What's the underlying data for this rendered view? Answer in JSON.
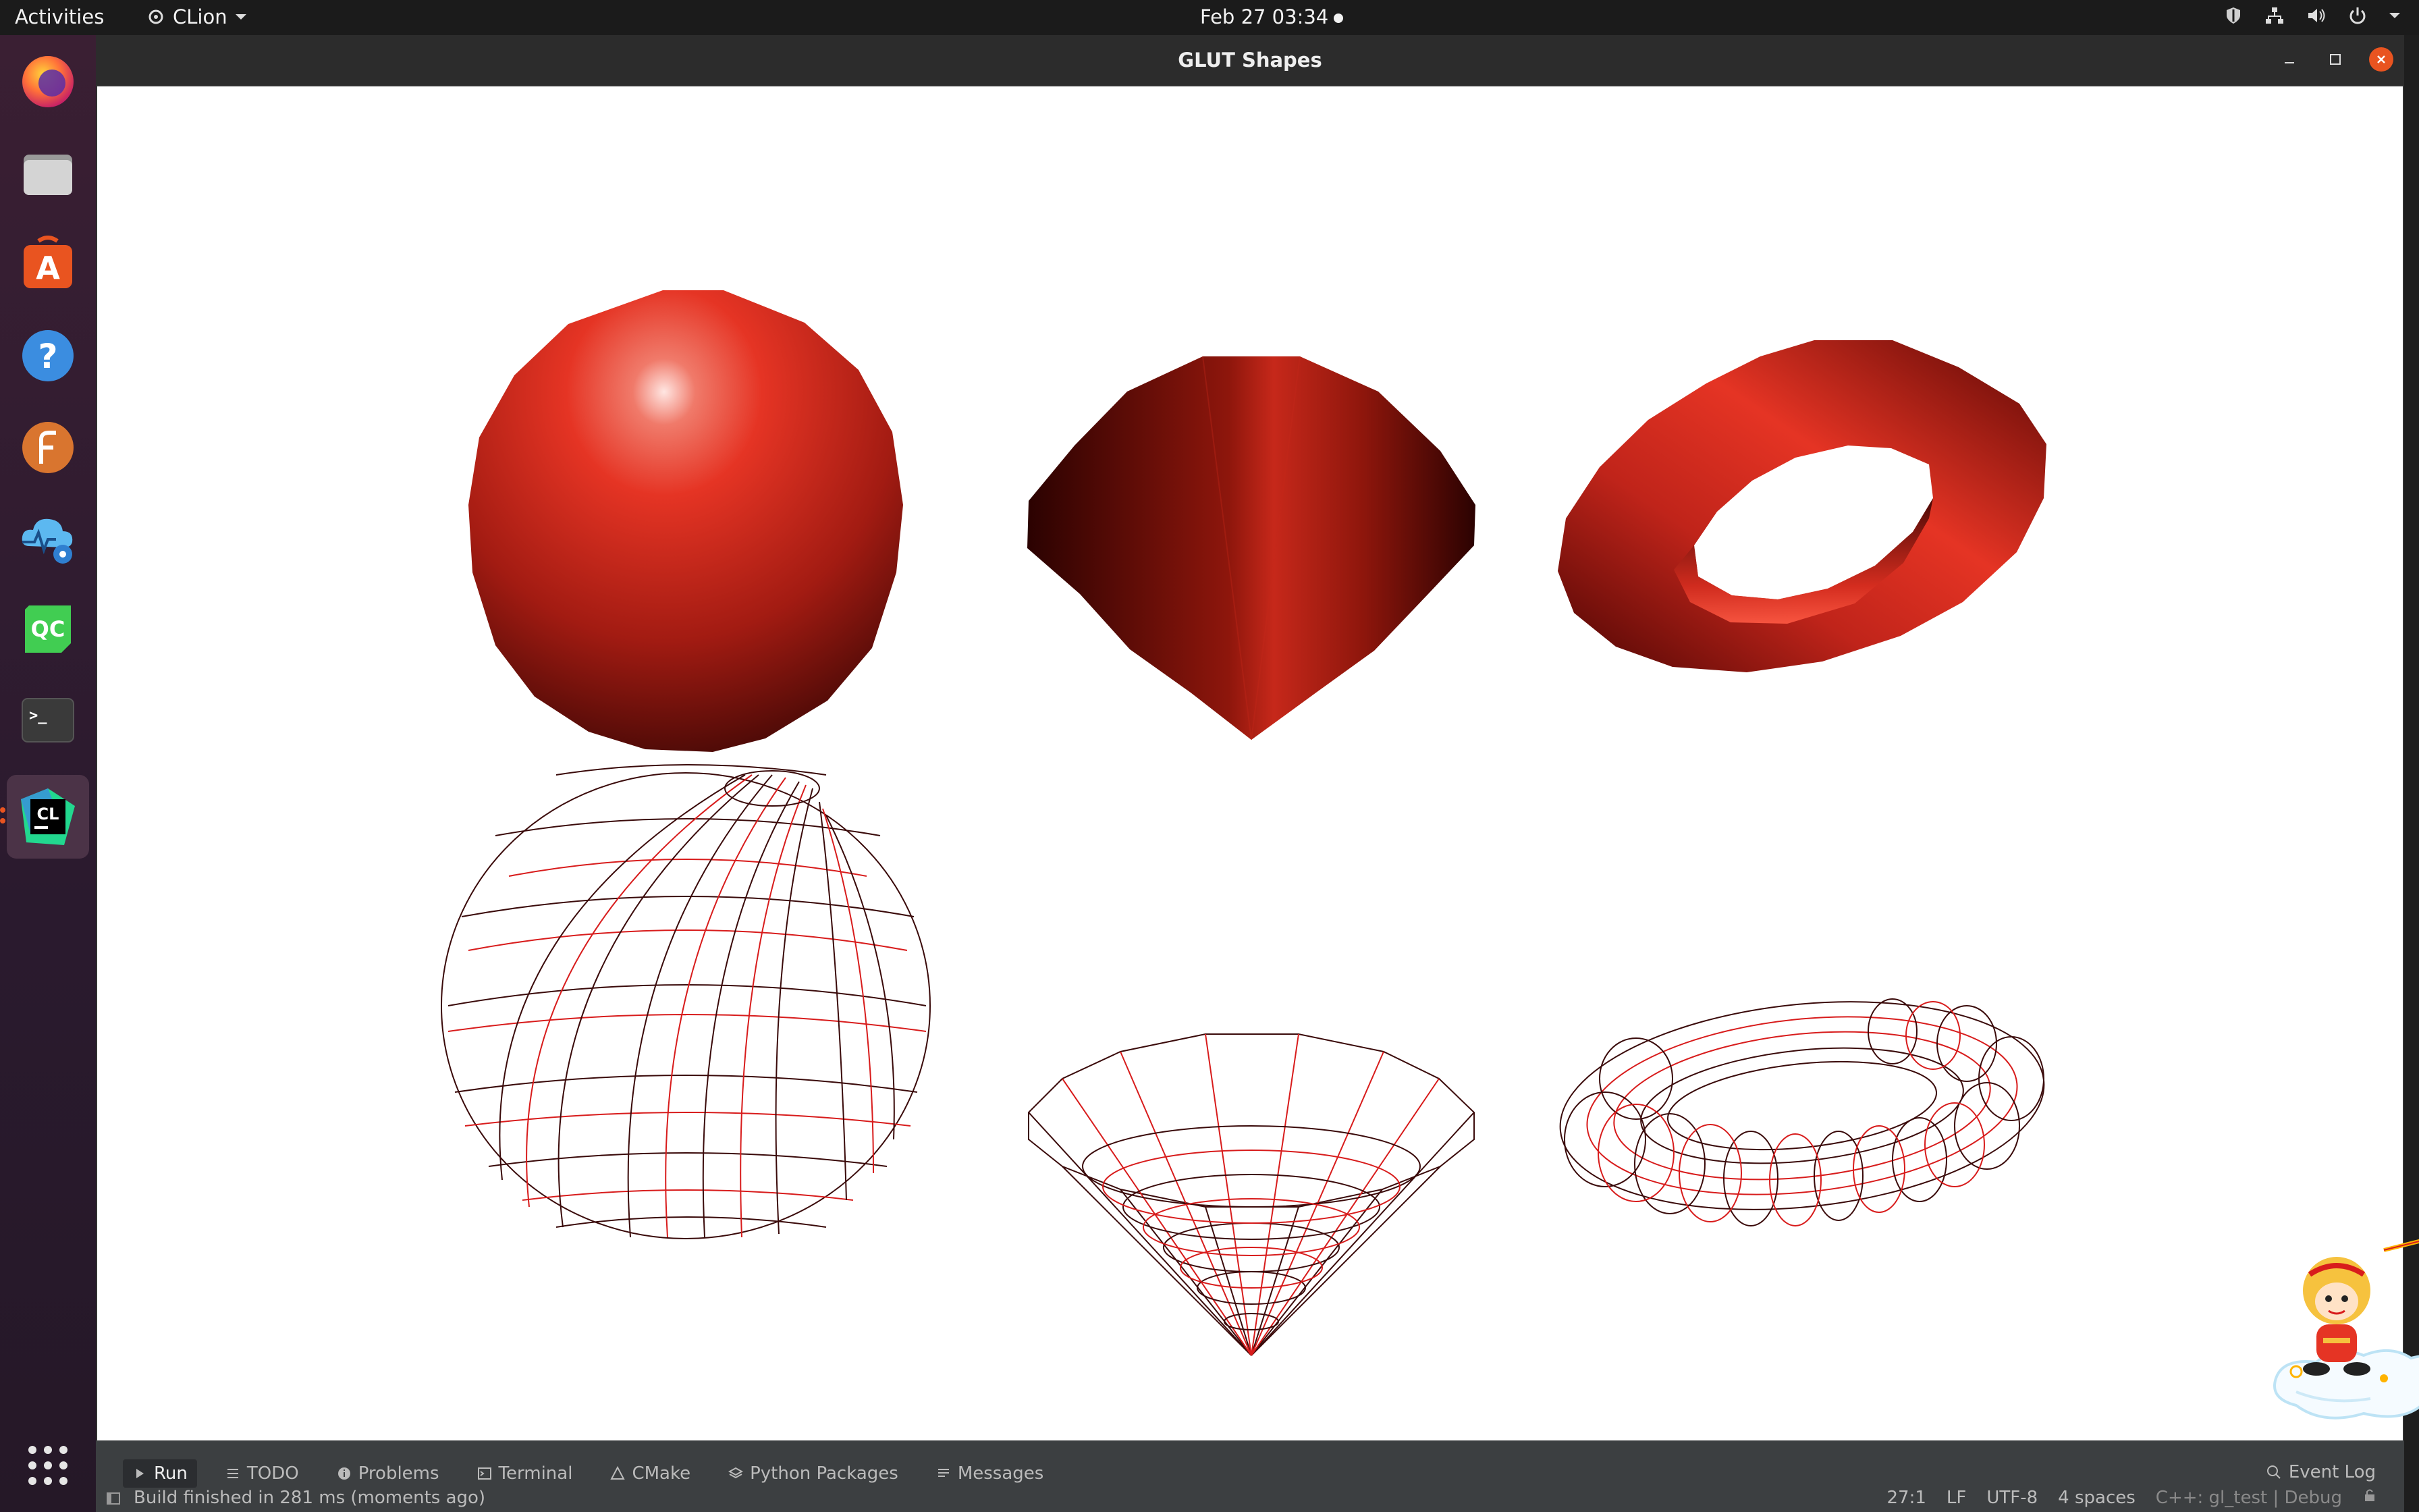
{
  "topbar": {
    "activities": "Activities",
    "app_name": "CLion",
    "clock": "Feb 27  03:34"
  },
  "dock": {
    "items": [
      {
        "name": "firefox-icon",
        "color": "#ff7139"
      },
      {
        "name": "files-icon",
        "color": "#b8b8b8"
      },
      {
        "name": "app-store-icon",
        "color": "#e95420",
        "label": "A"
      },
      {
        "name": "help-icon",
        "color": "#3b8de0",
        "label": "?"
      },
      {
        "name": "fontforge-icon",
        "color": "#d9752f",
        "label": "F"
      },
      {
        "name": "cloud-monitor-icon",
        "color": "#3aa0e8"
      },
      {
        "name": "qt-creator-icon",
        "color": "#41cd52",
        "label": "QC"
      },
      {
        "name": "terminal-icon",
        "color": "#2d2d2d",
        "label": ">_"
      },
      {
        "name": "clion-icon",
        "color": "#22d88f",
        "label": "CL"
      }
    ],
    "show_apps_icon": "apps-grid-icon"
  },
  "window": {
    "title": "GLUT Shapes"
  },
  "scene": {
    "solid_color": "#e53424",
    "wire_colors": [
      "#d81c1c",
      "#3a0a0a"
    ],
    "shapes_top": [
      "solid-sphere",
      "solid-cone",
      "solid-torus"
    ],
    "shapes_bottom": [
      "wire-sphere",
      "wire-cone",
      "wire-torus"
    ]
  },
  "ide": {
    "tabs": [
      {
        "label": "Run",
        "icon": "run-icon",
        "selected": true
      },
      {
        "label": "TODO",
        "icon": "todo-list-icon",
        "selected": false
      },
      {
        "label": "Problems",
        "icon": "info-icon",
        "selected": false
      },
      {
        "label": "Terminal",
        "icon": "terminal-small-icon",
        "selected": false
      },
      {
        "label": "CMake",
        "icon": "cmake-icon",
        "selected": false
      },
      {
        "label": "Python Packages",
        "icon": "layers-icon",
        "selected": false
      },
      {
        "label": "Messages",
        "icon": "messages-icon",
        "selected": false
      }
    ],
    "event_log": "Event Log",
    "status_message": "Build finished in 281 ms (moments ago)",
    "status_right": {
      "position": "27:1",
      "line_ending": "LF",
      "encoding": "UTF-8",
      "indent": "4 spaces",
      "context": "C++: gl_test | Debug"
    }
  }
}
